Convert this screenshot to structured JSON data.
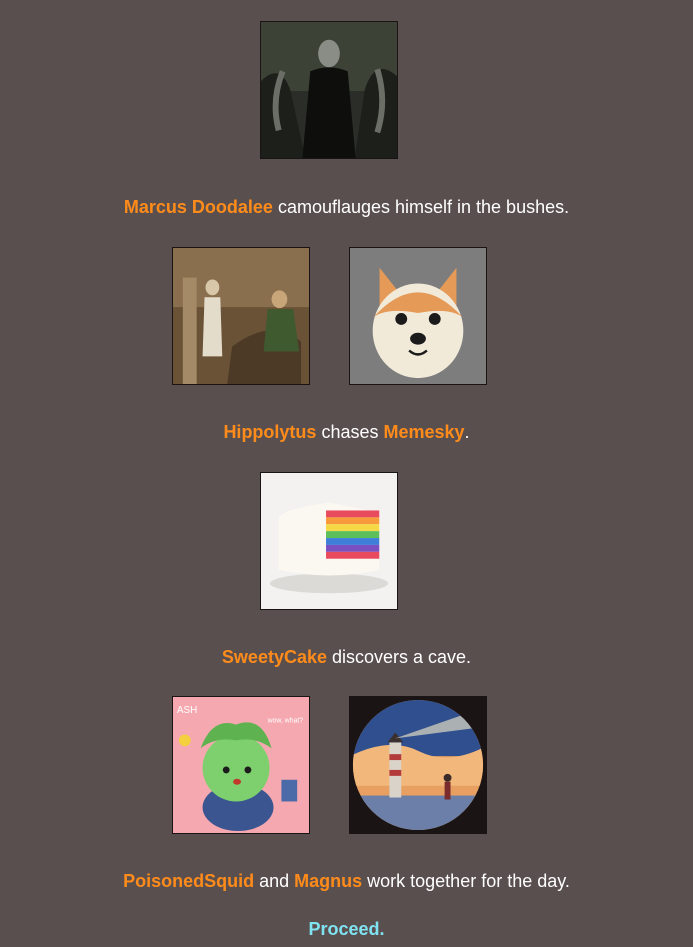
{
  "events": [
    {
      "avatars": [
        {
          "name": "Marcus Doodalee",
          "icon": "dark-figure-avatar-icon"
        }
      ],
      "tributes": [
        "Marcus Doodalee"
      ],
      "text_after_1": " camouflauges himself in the bushes."
    },
    {
      "avatars": [
        {
          "name": "Hippolytus",
          "icon": "classical-painting-avatar-icon"
        },
        {
          "name": "Memesky",
          "icon": "shiba-dog-avatar-icon"
        }
      ],
      "tributes": [
        "Hippolytus",
        "Memesky"
      ],
      "text_after_1": " chases ",
      "text_after_2": "."
    },
    {
      "avatars": [
        {
          "name": "SweetyCake",
          "icon": "rainbow-cake-avatar-icon"
        }
      ],
      "tributes": [
        "SweetyCake"
      ],
      "text_after_1": " discovers a cave."
    },
    {
      "avatars": [
        {
          "name": "PoisonedSquid",
          "icon": "green-cartoon-avatar-icon"
        },
        {
          "name": "Magnus",
          "icon": "lighthouse-avatar-icon"
        }
      ],
      "tributes": [
        "PoisonedSquid",
        "Magnus"
      ],
      "text_after_1": " and ",
      "text_after_2": " work together for the day."
    }
  ],
  "avatar_text": {
    "green_cartoon_caption_left": "ASH",
    "green_cartoon_caption_right": "wow, what?"
  },
  "proceed_label": "Proceed.",
  "colors": {
    "background": "#5a4f4f",
    "tribute_name": "#ff8c1a",
    "proceed_link": "#7fe3f2",
    "text": "#ffffff"
  }
}
